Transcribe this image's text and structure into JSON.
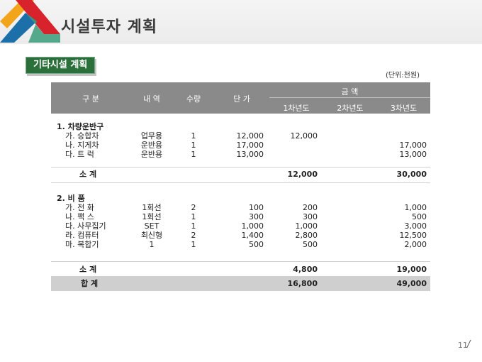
{
  "page": {
    "title": "시설투자 계획",
    "section": "기타시설 계획",
    "unit": "(단위:천원)",
    "page_number": "11"
  },
  "table": {
    "headers": {
      "category": "구 분",
      "detail": "내 역",
      "qty": "수량",
      "unit_price": "단 가",
      "amount": "금     액",
      "year1": "1차년도",
      "year2": "2차년도",
      "year3": "3차년도"
    },
    "group1": {
      "title": "1. 차량운반구",
      "rows": [
        {
          "label": "가. 승합차",
          "detail": "업무용",
          "qty": "1",
          "price": "12,000",
          "y1": "12,000",
          "y2": "",
          "y3": ""
        },
        {
          "label": "나. 지게차",
          "detail": "운반용",
          "qty": "1",
          "price": "17,000",
          "y1": "",
          "y2": "",
          "y3": "17,000"
        },
        {
          "label": "다. 트   럭",
          "detail": "운반용",
          "qty": "1",
          "price": "13,000",
          "y1": "",
          "y2": "",
          "y3": "13,000"
        }
      ],
      "subtotal": {
        "label": "소   계",
        "y1": "12,000",
        "y2": "",
        "y3": "30,000"
      }
    },
    "group2": {
      "title": "2. 비 품",
      "rows": [
        {
          "label": "가. 전  화",
          "detail": "1회선",
          "qty": "2",
          "price": "100",
          "y1": "200",
          "y2": "",
          "y3": "1,000"
        },
        {
          "label": "나. 팩  스",
          "detail": "1회선",
          "qty": "1",
          "price": "300",
          "y1": "300",
          "y2": "",
          "y3": "500"
        },
        {
          "label": "다. 사무집기",
          "detail": "SET",
          "qty": "1",
          "price": "1,000",
          "y1": "1,000",
          "y2": "",
          "y3": "3,000"
        },
        {
          "label": "라. 컴퓨터",
          "detail": "최신형",
          "qty": "2",
          "price": "1,400",
          "y1": "2,800",
          "y2": "",
          "y3": "12,500"
        },
        {
          "label": "마. 복합기",
          "detail": "1",
          "qty": "1",
          "price": "500",
          "y1": "500",
          "y2": "",
          "y3": "2,000"
        }
      ],
      "subtotal": {
        "label": "소   계",
        "y1": "4,800",
        "y2": "",
        "y3": "19,000"
      }
    },
    "total": {
      "label": "합   계",
      "y1": "16,800",
      "y2": "",
      "y3": "49,000"
    }
  },
  "colors": {
    "header_bg": "#8a8a8a",
    "badge_bg": "#2b6f3a",
    "total_bg": "#cfcfcf"
  }
}
